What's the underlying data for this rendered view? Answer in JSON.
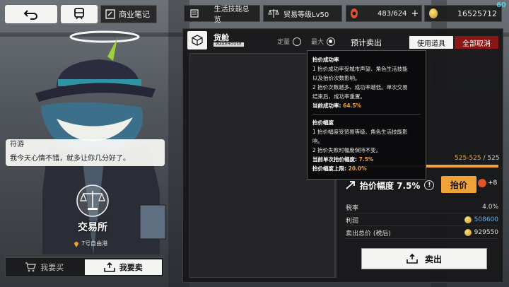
{
  "top_left": {
    "notes_label": "商业笔记"
  },
  "status": {
    "skills_label": "生活技能总览",
    "trade_level_label": "贸易等级Lv50",
    "stamina": "483/624",
    "coins": "16525712",
    "fps": "60"
  },
  "npc": {
    "name": "符游",
    "line": "我今天心情不错，就多让你几分好了。",
    "place": "交易所",
    "location": "7号自由港"
  },
  "mode": {
    "buy_label": "我要买",
    "sell_label": "我要卖",
    "active": "sell"
  },
  "panel": {
    "title": "货舱",
    "subtitle": "WAREHOUSE",
    "opt_fixed": "定量",
    "opt_max": "最大",
    "selected_option": "max",
    "presell_label": "预计卖出",
    "use_item_label": "使用道具",
    "cancel_all_label": "全部取消"
  },
  "tooltip": {
    "s1_title": "抬价成功率",
    "s1_l1": "1 抬价成功率受城市声望、角色生活技能",
    "s1_l2": "以及抬价次数影响。",
    "s1_l3": "2 抬价次数越多，成功率越低。单次交易",
    "s1_l4": "结束后，成功率重置。",
    "s1_cur_label": "当前成功率:",
    "s1_cur_value": "64.5%",
    "s2_title": "抬价幅度",
    "s2_l1": "1 抬价幅度受贸易等级、角色生活技能影",
    "s2_l2": "响。",
    "s2_l3": "2 抬价失败时幅度保持不变。",
    "s2_single_label": "当前单次抬价幅度:",
    "s2_single_value": "7.5%",
    "s2_cap_label": "抬价幅度上限:",
    "s2_cap_value": "20.0%"
  },
  "summary": {
    "qty_current": "525",
    "qty_sep": "-",
    "qty_selected": "525",
    "qty_max": "/ 525",
    "qty_fraction": 1.0,
    "bargain_label": "抬价幅度 7.5%",
    "bargain_button": "抬价",
    "bargain_bonus": "+8",
    "tax_label": "税率",
    "tax_value": "4.0%",
    "profit_label": "利润",
    "profit_value": "508600",
    "total_label": "卖出总价 (税后)",
    "total_value": "929550",
    "sell_button": "卖出"
  },
  "colors": {
    "accent": "#f0a23a",
    "danger": "#8b1616",
    "profit": "#6ab2ec",
    "fps": "#55d6e0"
  }
}
